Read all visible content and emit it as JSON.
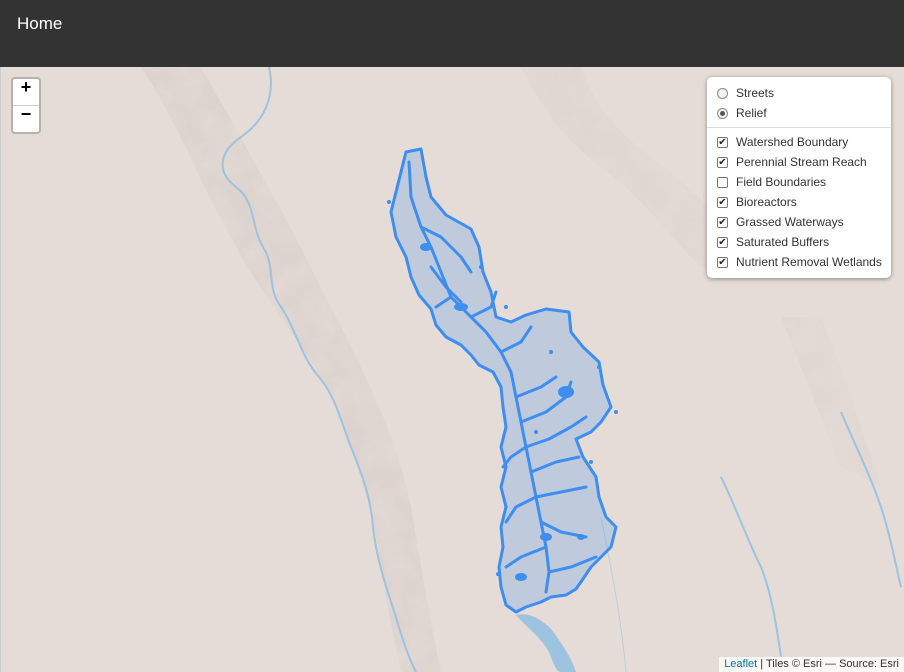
{
  "nav": {
    "home_label": "Home"
  },
  "zoom": {
    "in_label": "+",
    "out_label": "−"
  },
  "layers": {
    "base": [
      {
        "label": "Streets",
        "selected": false
      },
      {
        "label": "Relief",
        "selected": true
      }
    ],
    "overlays": [
      {
        "label": "Watershed Boundary",
        "checked": true
      },
      {
        "label": "Perennial Stream Reach",
        "checked": true
      },
      {
        "label": "Field Boundaries",
        "checked": false
      },
      {
        "label": "Bioreactors",
        "checked": true
      },
      {
        "label": "Grassed Waterways",
        "checked": true
      },
      {
        "label": "Saturated Buffers",
        "checked": true
      },
      {
        "label": "Nutrient Removal Wetlands",
        "checked": true
      }
    ]
  },
  "attribution": {
    "leaflet": "Leaflet",
    "rest": " | Tiles © Esri — Source: Esri"
  },
  "colors": {
    "watershed": "#3d8ef0",
    "river": "#9cc3e0",
    "relief": "#e5dcd7",
    "topbar": "#333333"
  }
}
